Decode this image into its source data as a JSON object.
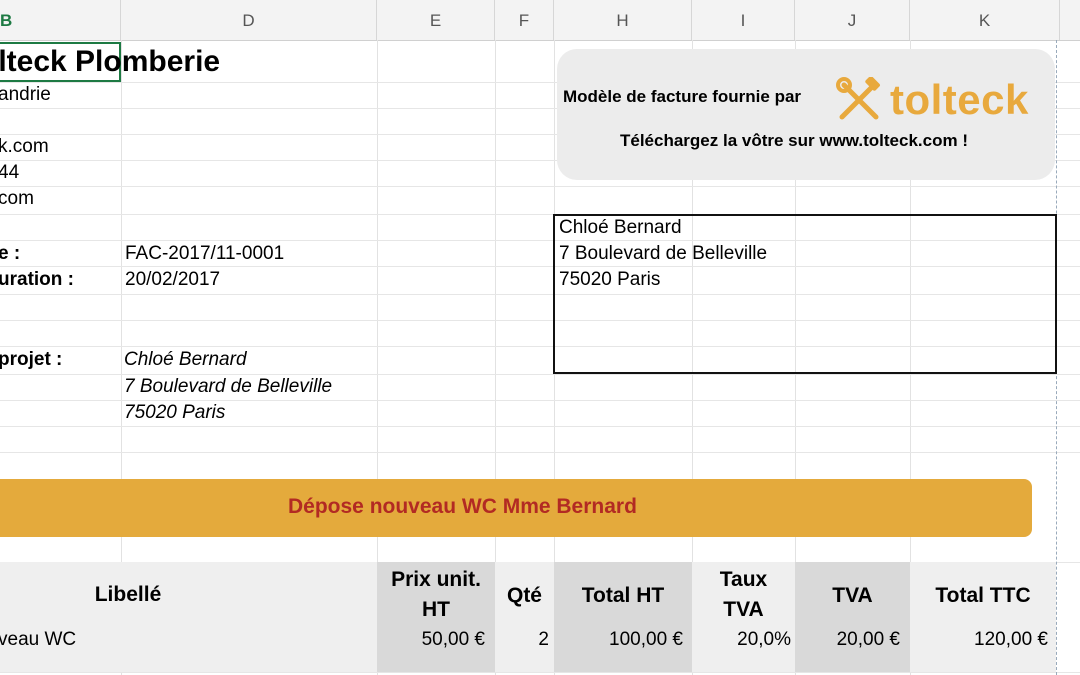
{
  "columns": [
    {
      "letter": "B",
      "selected": true
    },
    {
      "letter": "D"
    },
    {
      "letter": "E"
    },
    {
      "letter": "F"
    },
    {
      "letter": "H"
    },
    {
      "letter": "I"
    },
    {
      "letter": "J"
    },
    {
      "letter": "K"
    }
  ],
  "company": {
    "name": "olteck Plomberie",
    "line1": "andrie",
    "line2": "k.com",
    "line3": "44",
    "line4": "com"
  },
  "invoice": {
    "number_label": "e :",
    "number_value": "FAC-2017/11-0001",
    "date_label": "uration :",
    "date_value": "20/02/2017",
    "project_label": "projet :",
    "project_name": "Chloé Bernard",
    "project_street": "7 Boulevard de Belleville",
    "project_city": "75020 Paris"
  },
  "promo": {
    "line1": "Modèle de facture fournie par",
    "line2": "Téléchargez la vôtre sur www.tolteck.com !",
    "logo_text": "tolteck",
    "logo_icon": "crossed-tools-icon",
    "accent_color": "#e8a93d"
  },
  "client": {
    "name": "Chloé Bernard",
    "street": "7 Boulevard de Belleville",
    "city": "75020 Paris"
  },
  "banner": {
    "text": "Dépose nouveau WC Mme Bernard",
    "bg_color": "#e4aa3c",
    "text_color": "#b22a23"
  },
  "table": {
    "headers": {
      "libelle": "Libellé",
      "prix_1": "Prix unit.",
      "prix_2": "HT",
      "qte": "Qté",
      "total_ht": "Total HT",
      "taux_1": "Taux",
      "taux_2": "TVA",
      "tva": "TVA",
      "total_ttc": "Total TTC"
    },
    "row": {
      "libelle": "veau WC",
      "prix": "50,00 €",
      "qte": "2",
      "total_ht": "100,00 €",
      "taux": "20,0%",
      "tva": "20,00 €",
      "total_ttc": "120,00 €"
    }
  }
}
